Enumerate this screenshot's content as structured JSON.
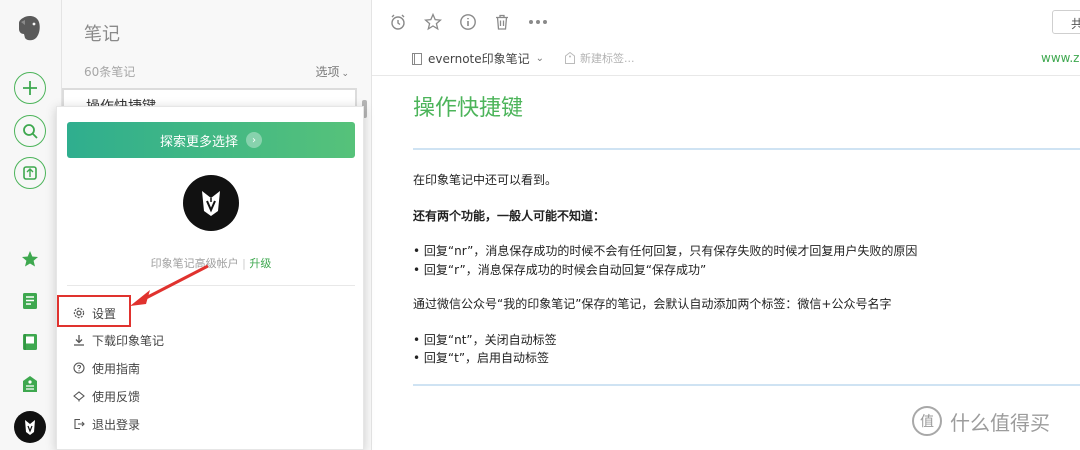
{
  "sidebar_rail": {
    "icons": [
      "elephant-logo",
      "new-note-icon",
      "search-icon",
      "work-chat-icon",
      "shortcuts-star-icon",
      "notes-icon",
      "notebooks-icon",
      "tags-icon",
      "account-avatar"
    ]
  },
  "note_list": {
    "title": "笔记",
    "count": "60条笔记",
    "options": "选项",
    "first_item": "操作快捷键"
  },
  "account_popup": {
    "explore_button": "探索更多选择",
    "account_type": "印象笔记高级帐户",
    "separator": "|",
    "upgrade_link": "升级",
    "menu": [
      {
        "label": "设置",
        "icon": "gear-icon"
      },
      {
        "label": "下载印象笔记",
        "icon": "download-icon"
      },
      {
        "label": "使用指南",
        "icon": "help-icon"
      },
      {
        "label": "使用反馈",
        "icon": "feedback-icon"
      },
      {
        "label": "退出登录",
        "icon": "logout-icon"
      }
    ]
  },
  "toolbar": {
    "icons": [
      "reminder-icon",
      "star-icon",
      "info-icon",
      "trash-icon",
      "more-icon"
    ],
    "share_label": "共享"
  },
  "note_meta": {
    "notebook": "evernote印象笔记",
    "tag_placeholder": "新建标签...",
    "url": "www.zh"
  },
  "note": {
    "title": "操作快捷键",
    "lines": [
      "在印象笔记中还可以看到。",
      "还有两个功能，一般人可能不知道：",
      "• 回复“nr”，消息保存成功的时候不会有任何回复，只有保存失败的时候才回复用户失败的原因",
      "• 回复“r”，消息保存成功的时候会自动回复“保存成功”",
      "通过微信公众号“我的印象笔记”保存的笔记，会默认自动添加两个标签：微信+公众号名字",
      "• 回复“nt”，关闭自动标签",
      "• 回复“t”，启用自动标签"
    ]
  },
  "watermark": {
    "glyph": "值",
    "text": "什么值得买"
  },
  "colors": {
    "accent_green": "#4cb45a",
    "annotation_red": "#e0322e",
    "divider_blue": "#cfe3f3"
  }
}
